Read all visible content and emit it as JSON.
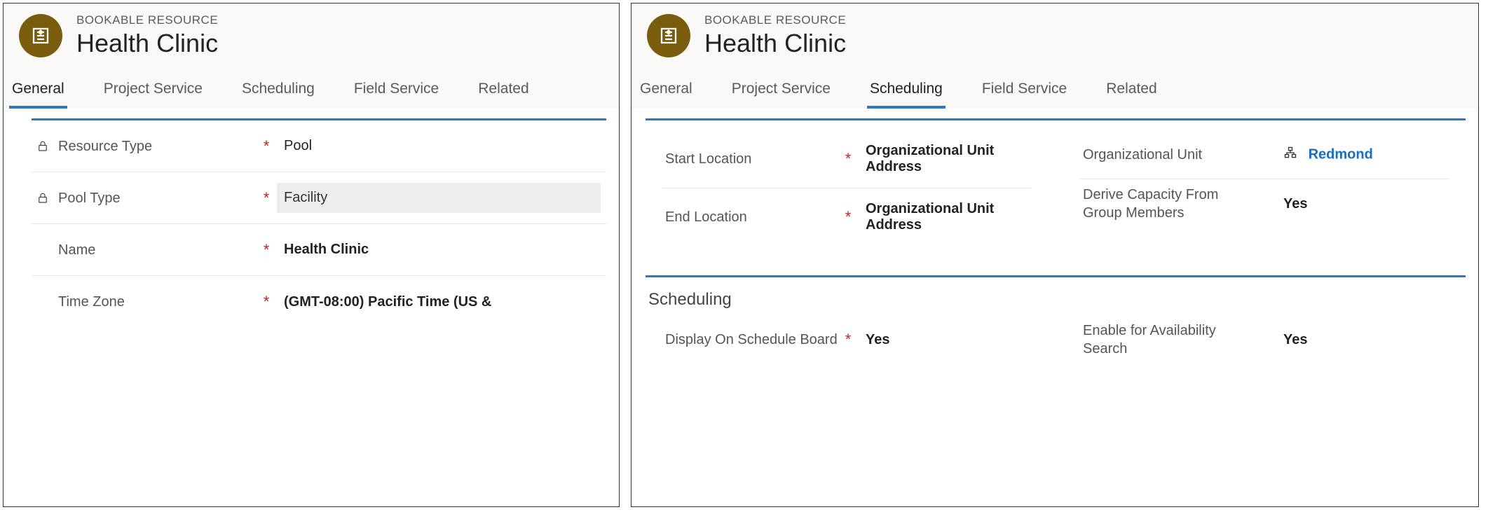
{
  "left": {
    "eyebrow": "BOOKABLE RESOURCE",
    "title": "Health Clinic",
    "tabs": [
      "General",
      "Project Service",
      "Scheduling",
      "Field Service",
      "Related"
    ],
    "active_tab_index": 0,
    "fields": {
      "resource_type": {
        "label": "Resource Type",
        "value": "Pool",
        "locked": true,
        "required": true
      },
      "pool_type": {
        "label": "Pool Type",
        "value": "Facility",
        "locked": true,
        "required": true
      },
      "name": {
        "label": "Name",
        "value": "Health Clinic",
        "locked": false,
        "required": true
      },
      "time_zone": {
        "label": "Time Zone",
        "value": "(GMT-08:00) Pacific Time (US &",
        "locked": false,
        "required": true
      }
    }
  },
  "right": {
    "eyebrow": "BOOKABLE RESOURCE",
    "title": "Health Clinic",
    "tabs": [
      "General",
      "Project Service",
      "Scheduling",
      "Field Service",
      "Related"
    ],
    "active_tab_index": 2,
    "section1": {
      "start_location": {
        "label": "Start Location",
        "value": "Organizational Unit Address",
        "required": true
      },
      "end_location": {
        "label": "End Location",
        "value": "Organizational Unit Address",
        "required": true
      },
      "org_unit": {
        "label": "Organizational Unit",
        "value": "Redmond"
      },
      "derive_capacity": {
        "label": "Derive Capacity From Group Members",
        "value": "Yes"
      }
    },
    "section2": {
      "heading": "Scheduling",
      "display_on_board": {
        "label": "Display On Schedule Board",
        "value": "Yes",
        "required": true
      },
      "enable_avail": {
        "label": "Enable for Availability Search",
        "value": "Yes"
      }
    }
  },
  "required_mark": "*"
}
